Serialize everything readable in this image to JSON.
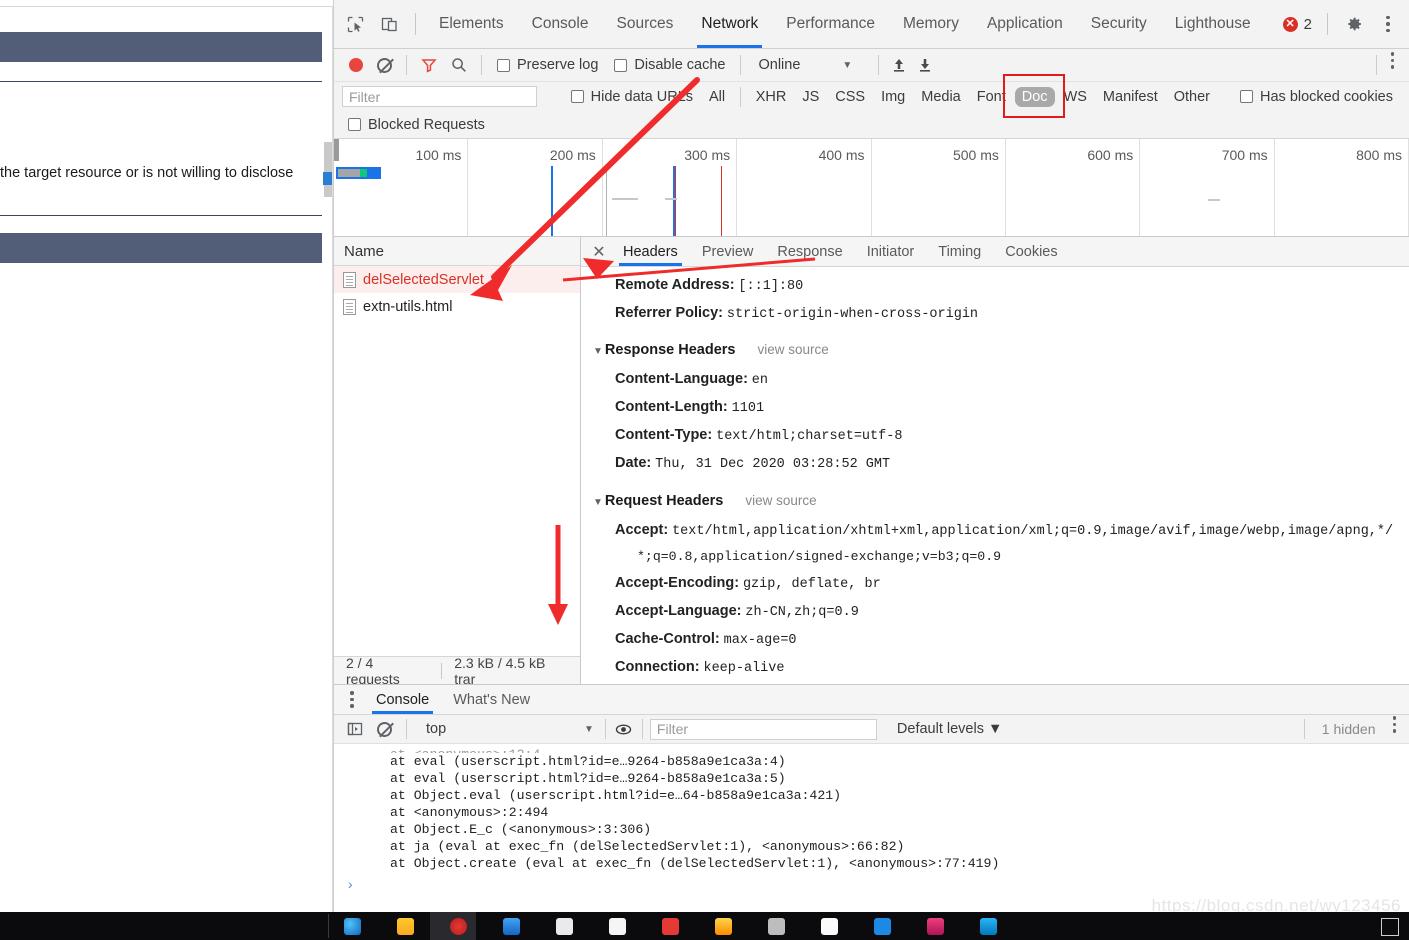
{
  "background_page": {
    "text_fragment": "the target resource or is not willing to disclose",
    "bar_color": "#525d77"
  },
  "devtools": {
    "tabs": [
      {
        "label": "Elements",
        "active": false
      },
      {
        "label": "Console",
        "active": false
      },
      {
        "label": "Sources",
        "active": false
      },
      {
        "label": "Network",
        "active": true
      },
      {
        "label": "Performance",
        "active": false
      },
      {
        "label": "Memory",
        "active": false
      },
      {
        "label": "Application",
        "active": false
      },
      {
        "label": "Security",
        "active": false
      },
      {
        "label": "Lighthouse",
        "active": false
      }
    ],
    "error_count": "2",
    "accent_color": "#1a73e8",
    "error_color": "#d93025"
  },
  "network_toolbar": {
    "preserve_log_label": "Preserve log",
    "disable_cache_label": "Disable cache",
    "throttling_value": "Online",
    "caret": "▼"
  },
  "filter_row": {
    "filter_placeholder": "Filter",
    "filter_value": "",
    "hide_data_urls_label": "Hide data URLs",
    "types": [
      {
        "label": "All",
        "selected": false
      },
      {
        "label": "XHR",
        "selected": false
      },
      {
        "label": "JS",
        "selected": false
      },
      {
        "label": "CSS",
        "selected": false
      },
      {
        "label": "Img",
        "selected": false
      },
      {
        "label": "Media",
        "selected": false
      },
      {
        "label": "Font",
        "selected": false
      },
      {
        "label": "Doc",
        "selected": true
      },
      {
        "label": "WS",
        "selected": false
      },
      {
        "label": "Manifest",
        "selected": false
      },
      {
        "label": "Other",
        "selected": false
      }
    ],
    "has_blocked_cookies_label": "Has blocked cookies",
    "blocked_requests_label": "Blocked Requests",
    "highlight_color": "#e01b1b"
  },
  "overview": {
    "ticks": [
      "100 ms",
      "200 ms",
      "300 ms",
      "400 ms",
      "500 ms",
      "600 ms",
      "700 ms",
      "800 ms"
    ]
  },
  "requests": {
    "column_header": "Name",
    "rows": [
      {
        "name": "delSelectedServlet",
        "error": true
      },
      {
        "name": "extn-utils.html",
        "error": false
      }
    ],
    "footer": {
      "requests": "2 / 4 requests",
      "transferred": "2.3 kB / 4.5 kB trar"
    }
  },
  "details": {
    "tabs": [
      {
        "label": "Headers",
        "active": true
      },
      {
        "label": "Preview",
        "active": false
      },
      {
        "label": "Response",
        "active": false
      },
      {
        "label": "Initiator",
        "active": false
      },
      {
        "label": "Timing",
        "active": false
      },
      {
        "label": "Cookies",
        "active": false
      }
    ],
    "close_icon": "✕",
    "general_rows": [
      {
        "name": "Remote Address:",
        "value": "[::1]:80"
      },
      {
        "name": "Referrer Policy:",
        "value": "strict-origin-when-cross-origin"
      }
    ],
    "response_headers": {
      "title": "Response Headers",
      "view_source": "view source",
      "rows": [
        {
          "name": "Content-Language:",
          "value": "en"
        },
        {
          "name": "Content-Length:",
          "value": "1101"
        },
        {
          "name": "Content-Type:",
          "value": "text/html;charset=utf-8"
        },
        {
          "name": "Date:",
          "value": "Thu, 31 Dec 2020 03:28:52 GMT"
        }
      ]
    },
    "request_headers": {
      "title": "Request Headers",
      "view_source": "view source",
      "accept_name": "Accept:",
      "accept_line1": "text/html,application/xhtml+xml,application/xml;q=0.9,image/avif,image/webp,image/apng,*/",
      "accept_line2": "*;q=0.8,application/signed-exchange;v=b3;q=0.9",
      "rows": [
        {
          "name": "Accept-Encoding:",
          "value": "gzip, deflate, br"
        },
        {
          "name": "Accept-Language:",
          "value": "zh-CN,zh;q=0.9"
        },
        {
          "name": "Cache-Control:",
          "value": "max-age=0"
        },
        {
          "name": "Connection:",
          "value": "keep-alive"
        }
      ]
    }
  },
  "drawer": {
    "tabs": [
      {
        "label": "Console",
        "active": true
      },
      {
        "label": "What's New",
        "active": false
      }
    ],
    "context": "top",
    "caret": "▼",
    "filter_placeholder": "Filter",
    "filter_value": "",
    "levels_label": "Default levels ▼",
    "hidden_label": "1 hidden",
    "console_lines": [
      "at eval (userscript.html?id=e…9264-b858a9e1ca3a:4)",
      "at eval (userscript.html?id=e…9264-b858a9e1ca3a:5)",
      "at Object.eval (userscript.html?id=e…64-b858a9e1ca3a:421)",
      "at <anonymous>:2:494",
      "at Object.E_c (<anonymous>:3:306)",
      "at ja (eval at exec_fn (delSelectedServlet:1), <anonymous>:66:82)",
      "at Object.create (eval at exec_fn (delSelectedServlet:1), <anonymous>:77:419)"
    ],
    "prompt_symbol": "›"
  },
  "watermark": "https://blog.csdn.net/wy123456"
}
